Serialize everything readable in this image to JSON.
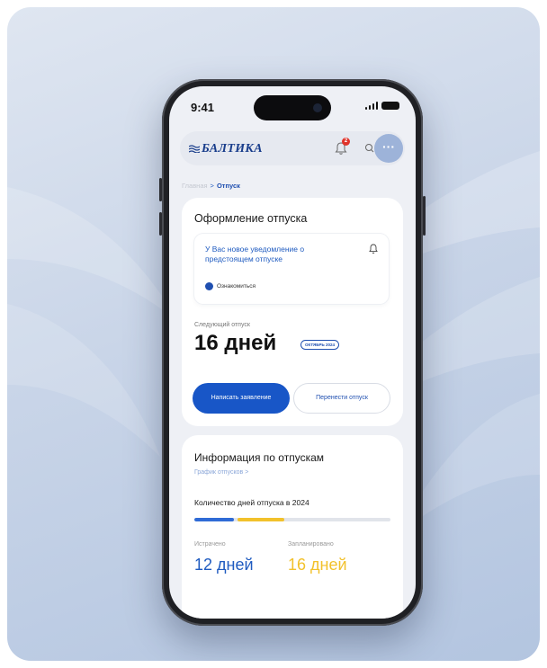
{
  "status_bar": {
    "time": "9:41"
  },
  "app_bar": {
    "logo": "БАЛТИКА",
    "notification_count": "2"
  },
  "breadcrumb": {
    "home": "Главная",
    "separator": ">",
    "current": "Отпуск"
  },
  "vacation_card": {
    "title": "Оформление отпуска",
    "notification": {
      "text": "У Вас новое уведомление о предстоящем отпуске",
      "link": "Ознакомиться"
    },
    "next_label": "Следующий отпуск",
    "days": "16 дней",
    "month_badge": "ОКТЯБРЬ 2024",
    "primary_button": "Написать заявление",
    "secondary_button": "Перенести отпуск"
  },
  "info_card": {
    "title": "Информация по отпускам",
    "schedule_link": "График отпусков  >",
    "count_label": "Количество дней отпуска в 2024",
    "progress": {
      "spent_fraction": 0.2,
      "planned_fraction": 0.24,
      "total": 1.0
    },
    "spent_label": "Истрачено",
    "spent_value": "12 дней",
    "planned_label": "Запланировано",
    "planned_value": "16 дней"
  },
  "colors": {
    "accent_blue": "#1856c7",
    "planned_yellow": "#f2c12b",
    "spent_blue": "#2f6bd6"
  }
}
